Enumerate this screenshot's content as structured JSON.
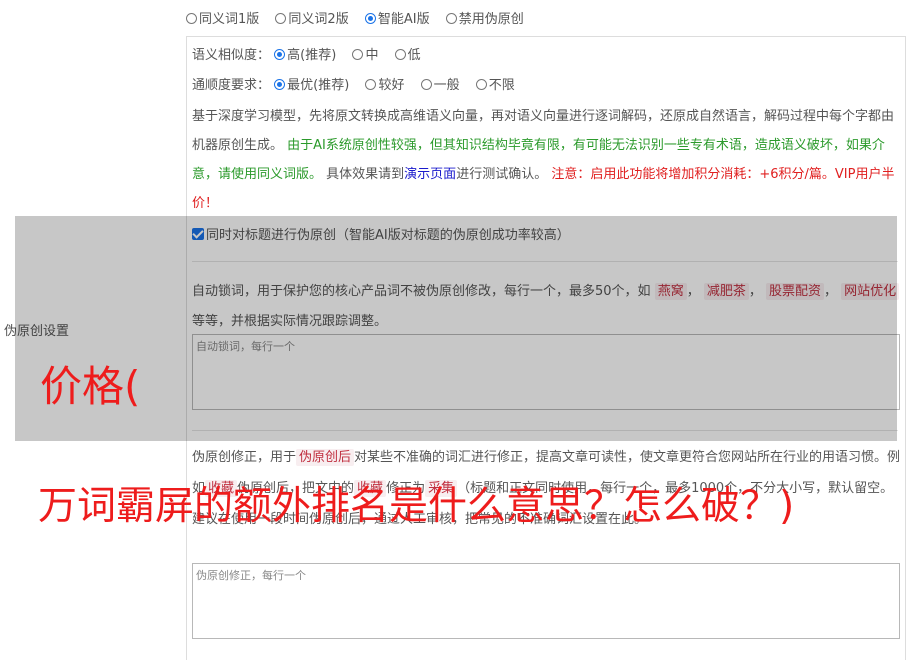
{
  "modes": [
    {
      "label": "同义词1版",
      "selected": false
    },
    {
      "label": "同义词2版",
      "selected": false
    },
    {
      "label": "智能AI版",
      "selected": true
    },
    {
      "label": "禁用伪原创",
      "selected": false
    }
  ],
  "similarity": {
    "label": "语义相似度：",
    "options": [
      {
        "label": "高(推荐)",
        "selected": true
      },
      {
        "label": "中",
        "selected": false
      },
      {
        "label": "低",
        "selected": false
      }
    ]
  },
  "fluency": {
    "label": "通顺度要求：",
    "options": [
      {
        "label": "最优(推荐)",
        "selected": true
      },
      {
        "label": "较好",
        "selected": false
      },
      {
        "label": "一般",
        "selected": false
      },
      {
        "label": "不限",
        "selected": false
      }
    ]
  },
  "description": {
    "intro": "基于深度学习模型，先将原文转换成高维语义向量，再对语义向量进行逐词解码，还原成自然语言，解码过程中每个字都由机器原创生成。",
    "warning_green": "由于AI系统原创性较强，但其知识结构毕竟有限，有可能无法识别一些专有术语，造成语义破坏，如果介意，请使用同义词版。",
    "effect_before": "具体效果请到",
    "demo_link": "演示页面",
    "effect_after": "进行测试确认。",
    "notice_red": "注意：启用此功能将增加积分消耗：+6积分/篇。VIP用户半价！"
  },
  "title_option": {
    "label": "同时对标题进行伪原创（智能AI版对标题的伪原创成功率较高）",
    "checked": true
  },
  "section_label": "伪原创设置",
  "lock_words": {
    "desc_before": "自动锁词，用于保护您的核心产品词不被伪原创修改，每行一个，最多50个，如",
    "examples": [
      "燕窝",
      "减肥茶",
      "股票配资",
      "网站优化"
    ],
    "desc_after": "等等，并根据实际情况跟踪调整。",
    "placeholder": "自动锁词，每行一个"
  },
  "correction": {
    "desc_before": "伪原创修正，用于",
    "tag1": "伪原创后",
    "desc_mid1": "对某些不准确的词汇进行修正，提高文章可读性，使文章更符合您网站所在行业的用语习惯。例如",
    "tag2": "收藏",
    "desc_mid2": "伪原创后，把文中的",
    "tag3": "收藏",
    "desc_mid3": "修正为",
    "tag4": "采集",
    "desc_after": "（标题和正文同时使用，每行一个，最多1000个，不分大小写，默认留空。建议在使用一段时间伪原创后，通过人工审核，把常见的不准确词汇设置在此。",
    "placeholder": "伪原创修正，每行一个"
  },
  "watermark": {
    "line1": "价格(",
    "line2": "万词霸屏的额外排名是什么意思？怎么破？)"
  }
}
